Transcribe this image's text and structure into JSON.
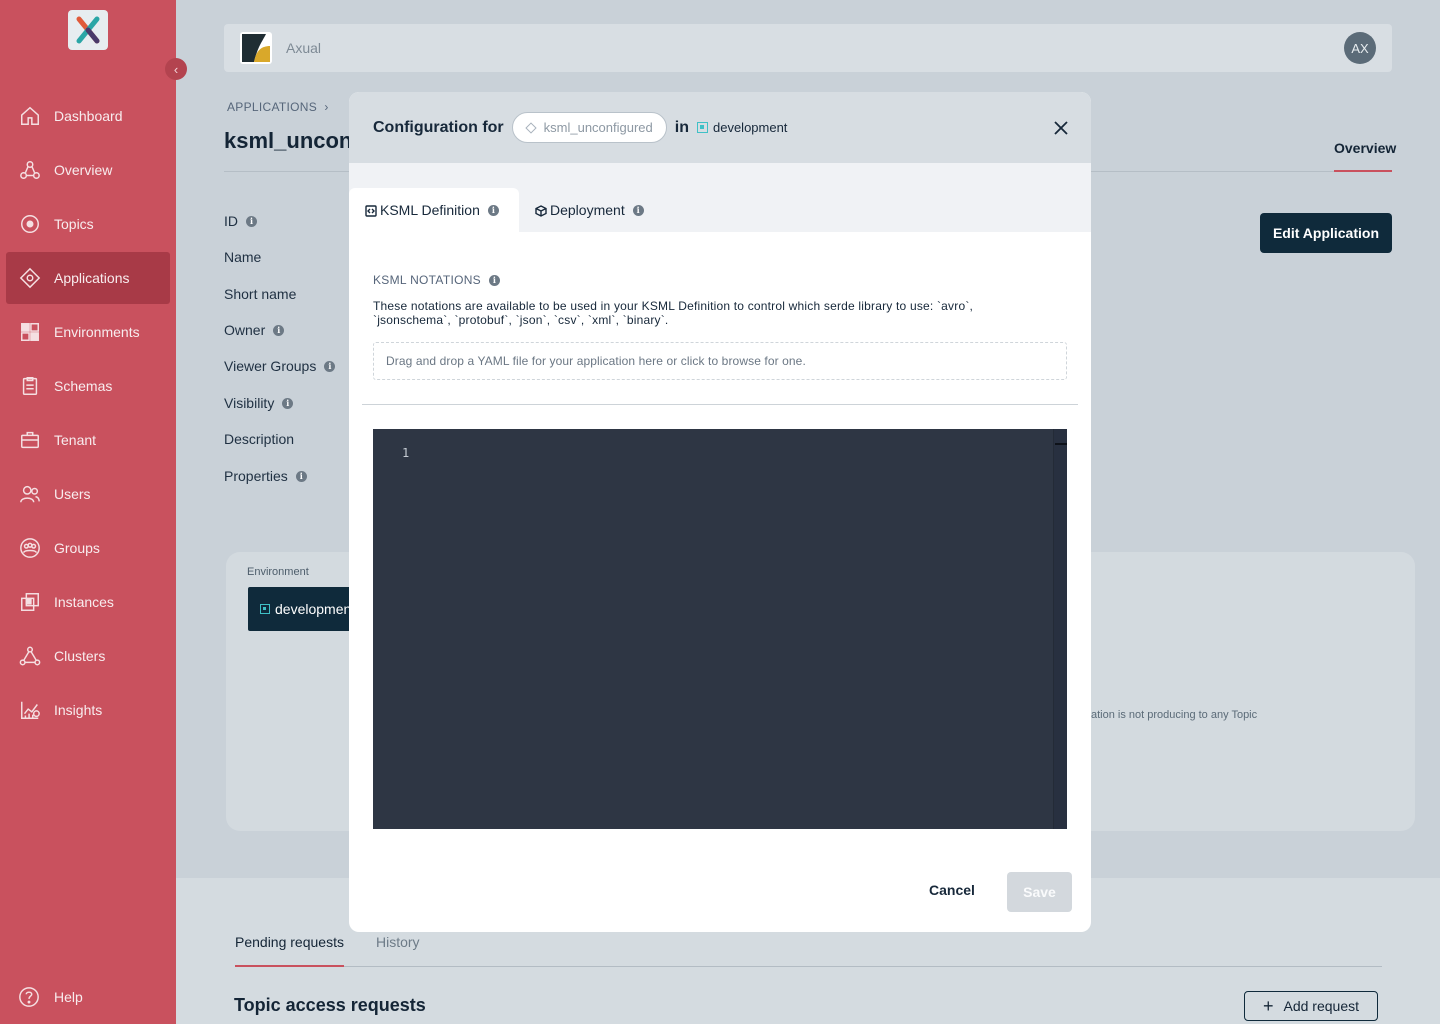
{
  "sidebar": {
    "items": [
      {
        "label": "Dashboard",
        "icon": "home-icon"
      },
      {
        "label": "Overview",
        "icon": "overview-icon"
      },
      {
        "label": "Topics",
        "icon": "topics-icon"
      },
      {
        "label": "Applications",
        "icon": "applications-icon"
      },
      {
        "label": "Environments",
        "icon": "environments-icon"
      },
      {
        "label": "Schemas",
        "icon": "schemas-icon"
      },
      {
        "label": "Tenant",
        "icon": "tenant-icon"
      },
      {
        "label": "Users",
        "icon": "users-icon"
      },
      {
        "label": "Groups",
        "icon": "groups-icon"
      },
      {
        "label": "Instances",
        "icon": "instances-icon"
      },
      {
        "label": "Clusters",
        "icon": "clusters-icon"
      },
      {
        "label": "Insights",
        "icon": "insights-icon"
      }
    ],
    "active": "Applications",
    "help_label": "Help"
  },
  "topbar": {
    "tenant_name": "Axual",
    "avatar_initials": "AX"
  },
  "page": {
    "breadcrumb": "APPLICATIONS",
    "title": "ksml_uncont",
    "tab_overview": "Overview",
    "fields": [
      "ID",
      "Name",
      "Short name",
      "Owner",
      "Viewer Groups",
      "Visibility",
      "Description",
      "Properties"
    ],
    "edit_button": "Edit Application",
    "env_label": "Environment",
    "env_chip": "developmen",
    "producing_note": "ation is not producing to any Topic",
    "lower_tabs": {
      "pending": "Pending requests",
      "history": "History"
    },
    "topic_requests_title": "Topic access requests",
    "add_request": "Add request"
  },
  "modal": {
    "title": "Configuration for",
    "app_name": "ksml_unconfigured",
    "in_word": "in",
    "environment": "development",
    "tabs": {
      "ksml": "KSML Definition",
      "deployment": "Deployment"
    },
    "notations_label": "KSML NOTATIONS",
    "notations_desc": "These notations are available to be used in your KSML Definition to control which serde library to use: `avro`, `jsonschema`, `protobuf`, `json`, `csv`, `xml`, `binary`.",
    "dropzone": "Drag and drop a YAML file for your application here or click to browse for one.",
    "editor_line": "1",
    "cancel": "Cancel",
    "save": "Save"
  },
  "colors": {
    "sidebar": "#c9515e",
    "active_item": "#a83a47",
    "primary": "#0f2a3b",
    "accent_line": "#c9515e",
    "env_teal": "#3fc0c6"
  }
}
